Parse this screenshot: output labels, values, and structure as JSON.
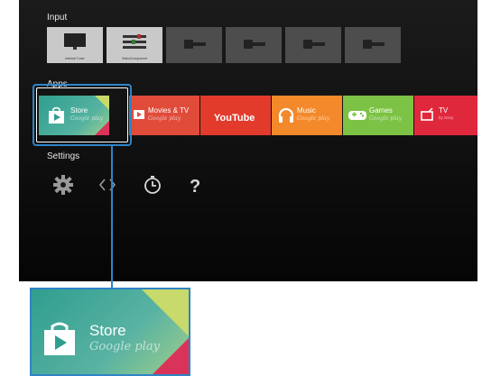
{
  "input": {
    "heading": "Input",
    "items": [
      {
        "caption": "Internal Tuner",
        "icon": "tv-icon"
      },
      {
        "caption": "Video/Component",
        "icon": "component-cable-icon"
      },
      {
        "caption": "",
        "icon": "hdmi-plug-icon"
      },
      {
        "caption": "",
        "icon": "hdmi-plug-icon"
      },
      {
        "caption": "",
        "icon": "hdmi-plug-icon"
      },
      {
        "caption": "",
        "icon": "hdmi-plug-icon"
      }
    ]
  },
  "apps": {
    "heading": "Apps",
    "items": [
      {
        "title": "Store",
        "subtitle": "Google play",
        "color": "#3aa598",
        "icon": "play-store-icon"
      },
      {
        "title": "Movies & TV",
        "subtitle": "Google play",
        "color": "#e14b3a",
        "icon": "movies-icon"
      },
      {
        "title": "YouTube",
        "subtitle": "",
        "color": "#e23b2c",
        "icon": "youtube-logo"
      },
      {
        "title": "Music",
        "subtitle": "Google play",
        "color": "#f3892a",
        "icon": "headphones-icon"
      },
      {
        "title": "Games",
        "subtitle": "Google play",
        "color": "#7cc245",
        "icon": "gamepad-icon"
      },
      {
        "title": "TV",
        "subtitle": "by Sony",
        "color": "#e0283d",
        "icon": "tv-sony-icon"
      }
    ]
  },
  "settings": {
    "heading": "Settings",
    "icons": [
      "gear-icon",
      "network-icon",
      "timer-icon",
      "help-icon"
    ]
  },
  "zoom": {
    "title": "Store",
    "subtitle": "Google play"
  },
  "colors": {
    "focus": "#2f84c6"
  }
}
